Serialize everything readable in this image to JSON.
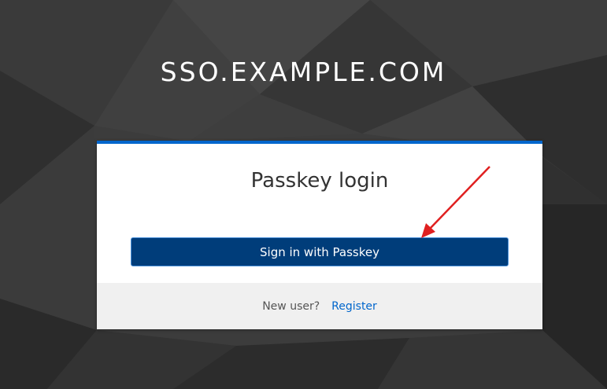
{
  "realm": {
    "title": "SSO.EXAMPLE.COM"
  },
  "login_card": {
    "heading": "Passkey login",
    "primary_button_label": "Sign in with Passkey",
    "footer": {
      "prompt": "New user?",
      "register_link": "Register"
    }
  },
  "colors": {
    "background": "#3c3c3c",
    "accent": "#0066cc",
    "button": "#003d7a",
    "annotation_arrow": "#e02020"
  }
}
